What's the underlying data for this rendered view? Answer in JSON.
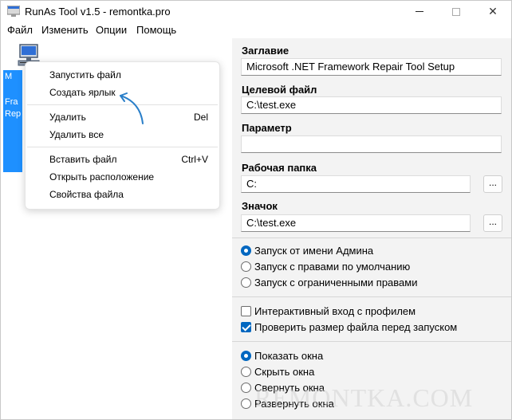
{
  "window": {
    "title": "RunAs Tool v1.5 - remontka.pro",
    "minimize_glyph": "—",
    "close_glyph": "✕"
  },
  "menubar": {
    "items": [
      "Файл",
      "Изменить",
      "Опции",
      "Помощь"
    ]
  },
  "left_panel": {
    "selected_tile_fragments": [
      "M",
      "Fra",
      "Rep"
    ]
  },
  "context_menu": {
    "items": [
      {
        "label": "Запустить файл",
        "shortcut": ""
      },
      {
        "label": "Создать ярлык",
        "shortcut": ""
      },
      {
        "label": "Удалить",
        "shortcut": "Del"
      },
      {
        "label": "Удалить все",
        "shortcut": ""
      },
      {
        "label": "Вставить файл",
        "shortcut": "Ctrl+V"
      },
      {
        "label": "Открыть расположение",
        "shortcut": ""
      },
      {
        "label": "Свойства файла",
        "shortcut": ""
      }
    ]
  },
  "form": {
    "title_label": "Заглавие",
    "title_value": "Microsoft .NET Framework Repair Tool Setup",
    "target_label": "Целевой файл",
    "target_value": "C:\\test.exe",
    "param_label": "Параметр",
    "param_value": "",
    "workdir_label": "Рабочая папка",
    "workdir_value": "C:",
    "icon_label": "Значок",
    "icon_value": "C:\\test.exe",
    "browse_label": "..."
  },
  "run_mode": {
    "options": [
      "Запуск от имени Админа",
      "Запуск с правами по умолчанию",
      "Запуск с ограниченными правами"
    ],
    "selected": 0
  },
  "checks": {
    "interactive_login": "Интерактивный вход с профилем",
    "interactive_login_checked": false,
    "verify_size": "Проверить размер файла перед запуском",
    "verify_size_checked": true
  },
  "window_mode": {
    "options": [
      "Показать окна",
      "Скрыть окна",
      "Свернуть окна",
      "Развернуть окна"
    ],
    "selected": 0
  },
  "watermark": "REMONTKA.COM",
  "colors": {
    "accent": "#0067c0",
    "selection": "#1e90ff",
    "arrow": "#2a7fc9"
  }
}
